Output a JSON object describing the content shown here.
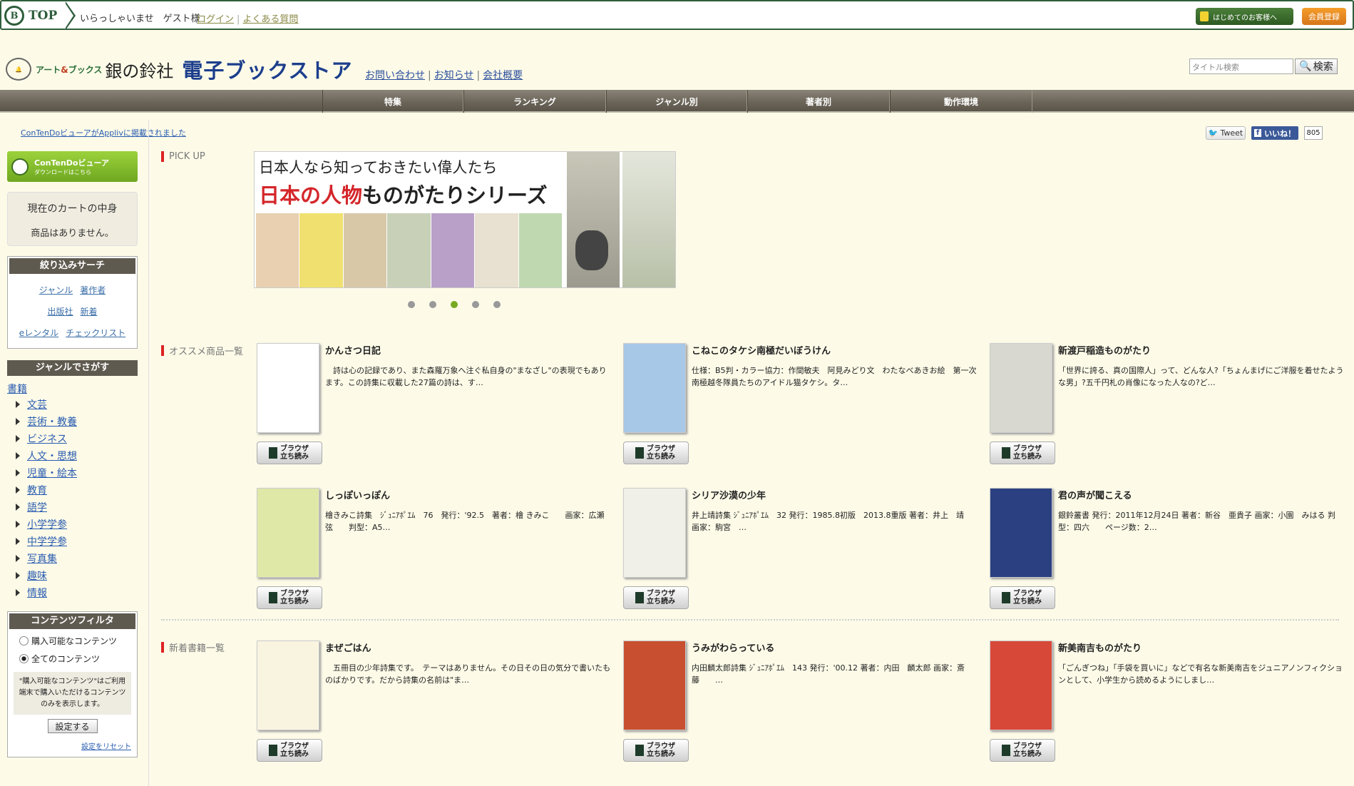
{
  "header": {
    "top_label": "TOP",
    "top_initial": "B",
    "welcome": "いらっしゃいませ　ゲスト様",
    "login": "ログイン",
    "faq": "よくある質問",
    "first_time_button": "はじめてのお客様へ",
    "member_button": "会員登録"
  },
  "brand": {
    "sub": "アート",
    "amp": "&",
    "sub2": "ブックス",
    "company": "銀の鈴社",
    "store": "電子ブックストア",
    "links": [
      "お問い合わせ",
      "お知らせ",
      "会社概要"
    ]
  },
  "search": {
    "placeholder": "タイトル検索",
    "button": "検索"
  },
  "nav": [
    "特集",
    "ランキング",
    "ジャンル別",
    "著者別",
    "動作環境"
  ],
  "notice": "ConTenDoビューアがApplivに掲載されました",
  "social": {
    "tweet": "Tweet",
    "like": "いいね！",
    "like_count": "805"
  },
  "sidebar": {
    "viewer_title": "ConTenDoビューア",
    "viewer_sub": "ダウンロードはこちら",
    "cart_heading": "現在のカートの中身",
    "cart_empty": "商品はありません。",
    "narrow_heading": "絞り込みサーチ",
    "narrow_links": [
      [
        "ジャンル",
        "著作者"
      ],
      [
        "出版社",
        "新着"
      ],
      [
        "eレンタル",
        "チェックリスト"
      ]
    ],
    "genre_heading": "ジャンルでさがす",
    "genre_root": "書籍",
    "genres": [
      "文芸",
      "芸術・教養",
      "ビジネス",
      "人文・思想",
      "児童・絵本",
      "教育",
      "語学",
      "小学学参",
      "中学学参",
      "写真集",
      "趣味",
      "情報"
    ],
    "filter_heading": "コンテンツフィルタ",
    "filter_options": [
      "購入可能なコンテンツ",
      "全てのコンテンツ"
    ],
    "filter_selected": 1,
    "filter_desc": "\"購入可能なコンテンツ\"はご利用端末で購入いただけるコンテンツのみを表示します。",
    "filter_button": "設定する",
    "filter_reset": "設定をリセット"
  },
  "pickup": {
    "heading": "PICK UP",
    "banner_line1": "日本人なら知っておきたい偉人たち",
    "banner_line2_red": "日本の人物",
    "banner_line2": "ものがたりシリーズ",
    "dots": 5,
    "active_dot": 2
  },
  "recommended": {
    "heading": "オススメ商品一覧",
    "items": [
      {
        "title": "かんさつ日記",
        "desc": "　詩は心の記録であり、また森羅万象へ注ぐ私自身の\"まなざし\"の表現でもあります。この詩集に収載した27篇の詩は、す…",
        "cover_color": "#ffffff"
      },
      {
        "title": "こねこのタケシ南極だいぼうけん",
        "desc": "仕様：B5判・カラー協力：作間敏夫　阿見みどり文　わたなべあきお絵　第一次南極越冬隊員たちのアイドル猫タケシ。タ…",
        "cover_color": "#a8c8e8"
      },
      {
        "title": "新渡戸稲造ものがたり",
        "desc": "「世界に誇る、真の国際人」って、どんな人?「ちょんまげにご洋服を着せたような男」?五千円札の肖像になった人なの?ど…",
        "cover_color": "#d8d8d0"
      },
      {
        "title": "しっぽいっぽん",
        "desc": "檜きみこ詩集　ｼﾞｭﾆｱﾎﾟｴﾑ　76　発行：'92.5　著者：檜 きみこ　　画家：広瀬 弦　　判型：A5…",
        "cover_color": "#e0e8a8"
      },
      {
        "title": "シリア沙漠の少年",
        "desc": "井上靖詩集 ｼﾞｭﾆｱﾎﾟｴﾑ　32 発行：1985.8初版　2013.8重版 著者：井上　靖　画家：駒宮　…",
        "cover_color": "#f0f0e8"
      },
      {
        "title": "君の声が聞こえる",
        "desc": "銀鈴叢書 発行：2011年12月24日 著者：新谷　亜貴子 画家：小園　みはる 判型：四六　　ページ数：2…",
        "cover_color": "#2a4080"
      }
    ],
    "read_button": [
      "ブラウザ",
      "立ち読み"
    ]
  },
  "newbooks": {
    "heading": "新着書籍一覧",
    "items": [
      {
        "title": "まぜごはん",
        "desc": "　五冊目の少年詩集です。　テーマはありません。その日その日の気分で書いたものばかりです。だから詩集の名前は\"ま…",
        "cover_color": "#f8f4e0"
      },
      {
        "title": "うみがわらっている",
        "desc": "内田麟太郎詩集 ｼﾞｭﾆｱﾎﾟｴﾑ　143 発行：'00.12 著者：内田　麟太郎 画家：斎藤　　…",
        "cover_color": "#c85030"
      },
      {
        "title": "新美南吉ものがたり",
        "desc": "「ごんぎつね」「手袋を買いに」などで有名な新美南吉をジュニアノンフィクションとして、小学生から読めるようにしまし…",
        "cover_color": "#d84838"
      }
    ]
  }
}
